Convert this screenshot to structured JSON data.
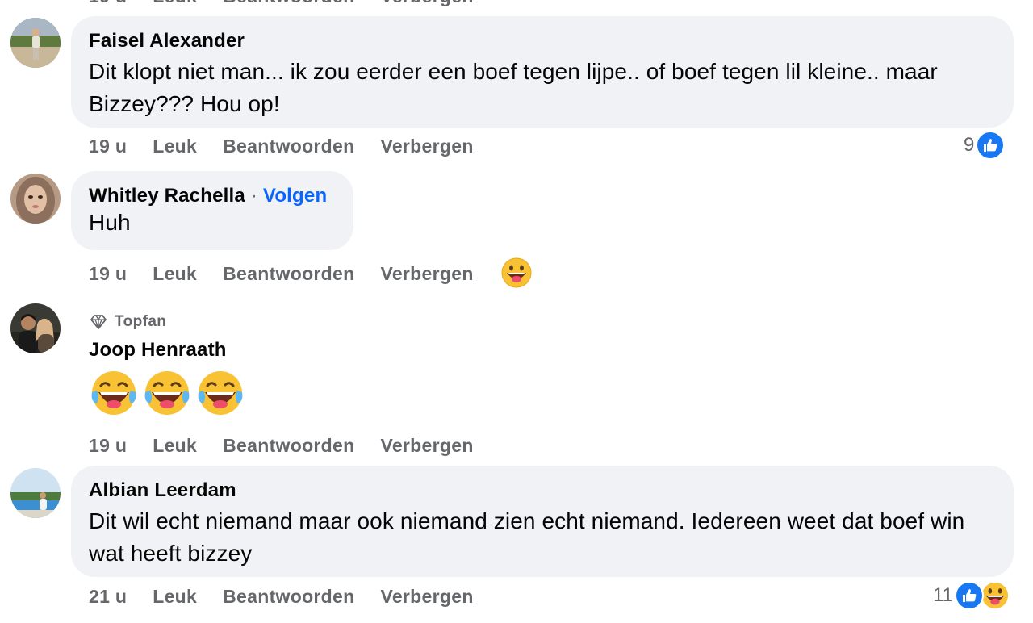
{
  "comments": [
    {
      "author": "Faisel Alexander",
      "text": "Dit klopt niet man... ik zou eerder een boef tegen lijpe.. of boef tegen lil kleine.. maar Bizzey??? Hou op!",
      "time": "19 u",
      "actions": [
        "Leuk",
        "Beantwoorden",
        "Verbergen"
      ],
      "reaction_count": "9",
      "reactions": [
        "like-icon"
      ]
    },
    {
      "author": "Whitley Rachella",
      "follow_sep": "·",
      "follow_label": "Volgen",
      "text": "Huh",
      "time": "19 u",
      "actions": [
        "Leuk",
        "Beantwoorden",
        "Verbergen"
      ],
      "reactions": [
        "grinning-tongue-emoji"
      ]
    },
    {
      "badge": "Topfan",
      "author": "Joop Henraath",
      "text_emojis": [
        "tears-of-joy-emoji",
        "tears-of-joy-emoji",
        "tears-of-joy-emoji"
      ],
      "time": "19 u",
      "actions": [
        "Leuk",
        "Beantwoorden",
        "Verbergen"
      ]
    },
    {
      "author": "Albian Leerdam",
      "text": "Dit wil echt niemand maar ook niemand zien echt niemand. Iedereen weet dat boef win wat heeft bizzey",
      "time": "21 u",
      "actions": [
        "Leuk",
        "Beantwoorden",
        "Verbergen"
      ],
      "reaction_count": "11",
      "reactions": [
        "like-icon",
        "grinning-tongue-emoji"
      ]
    }
  ],
  "colors": {
    "bubble": "#f0f2f5",
    "meta_text": "#65676b",
    "link_blue": "#0866ff",
    "like_blue": "#1877f2"
  }
}
